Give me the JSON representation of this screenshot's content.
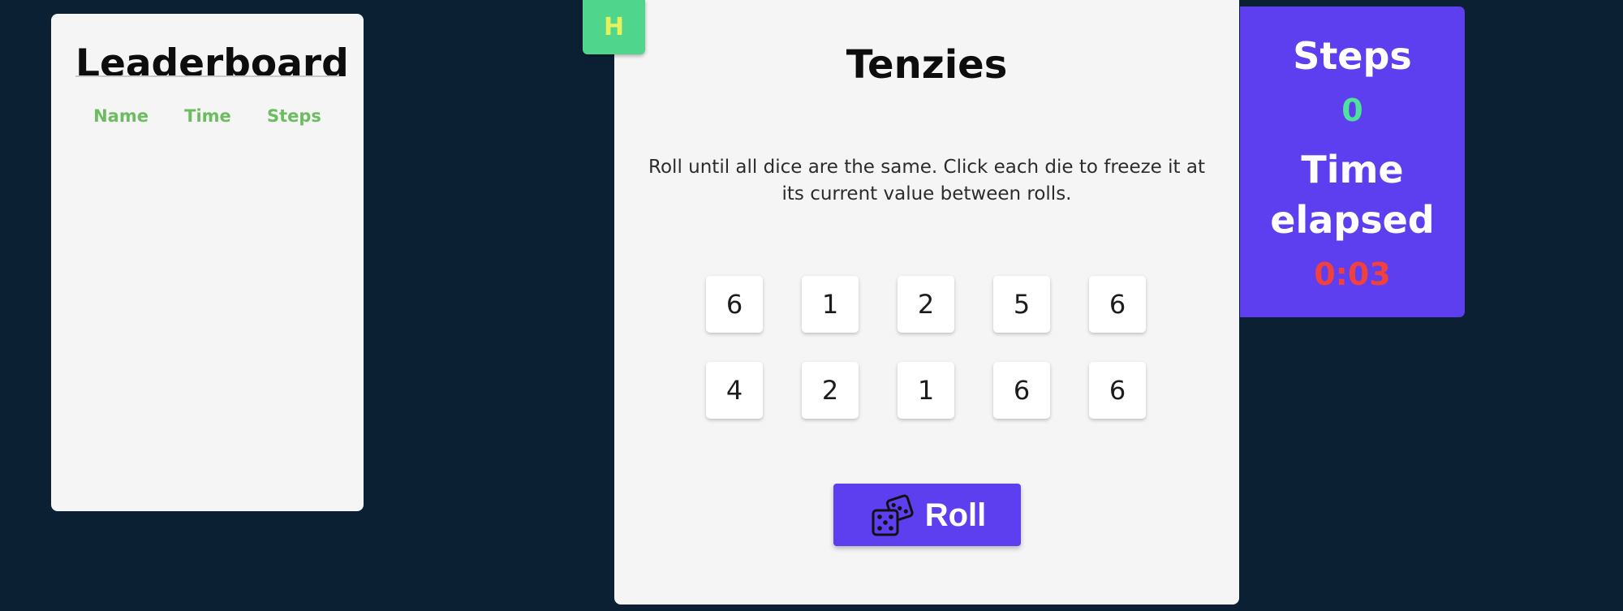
{
  "leaderboard": {
    "title": "Leaderboard",
    "columns": [
      "Name",
      "Time",
      "Steps"
    ],
    "rows": []
  },
  "hint_badge": {
    "label": "H",
    "color": "#4fd68c"
  },
  "game": {
    "title": "Tenzies",
    "instructions": "Roll until all dice are the same. Click each die to freeze it at its current value between rolls.",
    "dice": [
      6,
      1,
      2,
      5,
      6,
      4,
      2,
      1,
      6,
      6
    ],
    "roll_button": {
      "label": "Roll",
      "icon": "dice-icon"
    }
  },
  "stats": {
    "steps_label": "Steps",
    "steps_value": "0",
    "time_label": "Time elapsed",
    "time_value": "0:03",
    "steps_color": "#4ee39a",
    "time_color": "#f2413c"
  },
  "colors": {
    "background": "#0b2133",
    "card": "#f5f5f5",
    "accent": "#5d3ff0",
    "leaderboard_header": "#6cbd5f"
  }
}
